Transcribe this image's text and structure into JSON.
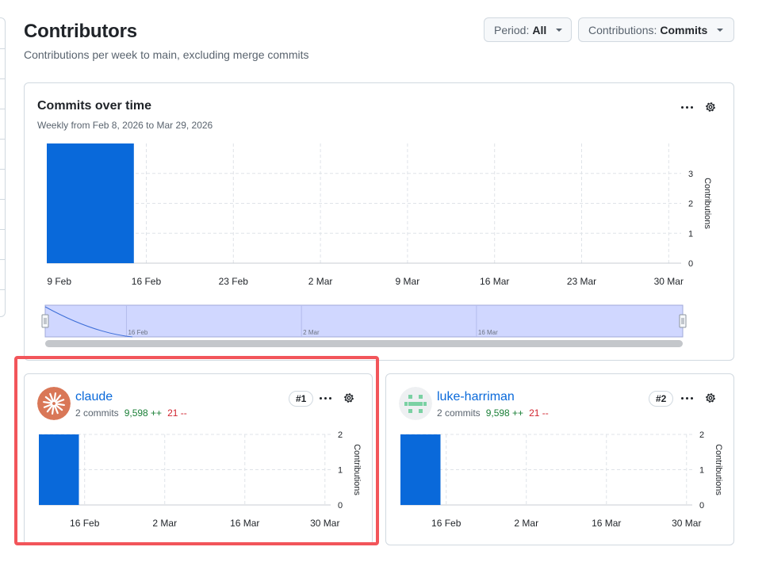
{
  "page": {
    "title": "Contributors",
    "subtitle": "Contributions per week to main, excluding merge commits"
  },
  "filters": {
    "period_label": "Period:",
    "period_value": "All",
    "contributions_label": "Contributions:",
    "contributions_value": "Commits"
  },
  "colors": {
    "bar": "#0969da",
    "brush_fill": "#d0d7ff",
    "brush_line": "#3e6fd8",
    "highlight": "#f2555a",
    "additions": "#1a7f37",
    "deletions": "#d1242f",
    "link": "#0969da"
  },
  "icons": [
    "kebab-horizontal-icon",
    "gear-icon",
    "dropdown-caret-icon",
    "claude-starburst-avatar",
    "identicon-avatar"
  ],
  "main_chart": {
    "title": "Commits over time",
    "subtitle": "Weekly from Feb 8, 2026 to Mar 29, 2026",
    "navigator_labels": [
      "16 Feb",
      "2 Mar",
      "16 Mar"
    ]
  },
  "contributors": [
    {
      "name": "claude",
      "rank": "#1",
      "commits": "2 commits",
      "additions": "9,598 ++",
      "deletions": "21 --"
    },
    {
      "name": "luke-harriman",
      "rank": "#2",
      "commits": "2 commits",
      "additions": "9,598 ++",
      "deletions": "21 --"
    }
  ],
  "chart_data": [
    {
      "type": "bar",
      "title": "Commits over time",
      "ylabel": "Contributions",
      "xlabel": "",
      "x_ticks": [
        "9 Feb",
        "16 Feb",
        "23 Feb",
        "2 Mar",
        "9 Mar",
        "16 Mar",
        "23 Mar",
        "30 Mar"
      ],
      "y_ticks": [
        0,
        1,
        2,
        3
      ],
      "ylim": [
        0,
        4
      ],
      "xlim": [
        "2026-02-08",
        "2026-03-31"
      ],
      "grid": true,
      "points": [
        {
          "week": "2026-02-08",
          "value": 4
        }
      ]
    },
    {
      "type": "bar",
      "title": "claude",
      "ylabel": "Contributions",
      "xlabel": "",
      "x_ticks": [
        "16 Feb",
        "2 Mar",
        "16 Mar",
        "30 Mar"
      ],
      "y_ticks": [
        0,
        1,
        2
      ],
      "ylim": [
        0,
        2
      ],
      "xlim": [
        "2026-02-08",
        "2026-03-31"
      ],
      "grid": true,
      "points": [
        {
          "week": "2026-02-08",
          "value": 2
        }
      ]
    },
    {
      "type": "bar",
      "title": "luke-harriman",
      "ylabel": "Contributions",
      "xlabel": "",
      "x_ticks": [
        "16 Feb",
        "2 Mar",
        "16 Mar",
        "30 Mar"
      ],
      "y_ticks": [
        0,
        1,
        2
      ],
      "ylim": [
        0,
        2
      ],
      "xlim": [
        "2026-02-08",
        "2026-03-31"
      ],
      "grid": true,
      "points": [
        {
          "week": "2026-02-08",
          "value": 2
        }
      ]
    }
  ]
}
